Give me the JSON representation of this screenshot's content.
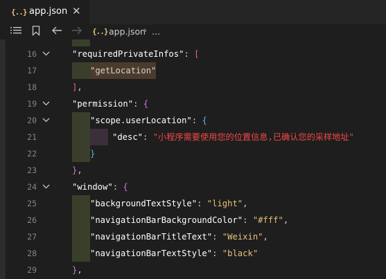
{
  "tab": {
    "icon": "{..}",
    "title": "app.json",
    "close": "✕"
  },
  "breadcrumb": {
    "icon": "{..}",
    "file": "app.json",
    "separator": "›",
    "more": "..."
  },
  "toolbar": {
    "list_icon": "list-icon",
    "bookmark_icon": "bookmark-icon",
    "back_icon": "arrow-left-icon",
    "forward_icon": "arrow-right-icon"
  },
  "line_numbers": [
    "16",
    "17",
    "18",
    "19",
    "20",
    "21",
    "22",
    "23",
    "24",
    "25",
    "26",
    "27",
    "28",
    "29"
  ],
  "code": {
    "required_key": "\"requiredPrivateInfos\"",
    "required_value": "\"getLocation\"",
    "permission_key": "\"permission\"",
    "scope_key": "\"scope.userLocation\"",
    "desc_key": "\"desc\"",
    "desc_value": "\"小程序需要使用您的位置信息,已确认您的采样地址\"",
    "window_key": "\"window\"",
    "bg_text_style_key": "\"backgroundTextStyle\"",
    "bg_text_style_value": "\"light\"",
    "nav_bg_color_key": "\"navigationBarBackgroundColor\"",
    "nav_bg_color_value": "\"#fff\"",
    "nav_title_key": "\"navigationBarTitleText\"",
    "nav_title_value": "\"Weixin\"",
    "nav_text_style_key": "\"navigationBarTextStyle\"",
    "nav_text_style_value": "\"black\""
  },
  "colors": {
    "background": "#1e1e1e",
    "key": "#ffffff",
    "string": "#e5c07b",
    "chinese_string": "#f44747",
    "bracket_outer": "#e06c75",
    "bracket_inner": "#c678dd",
    "bracket_deep": "#61afef"
  }
}
